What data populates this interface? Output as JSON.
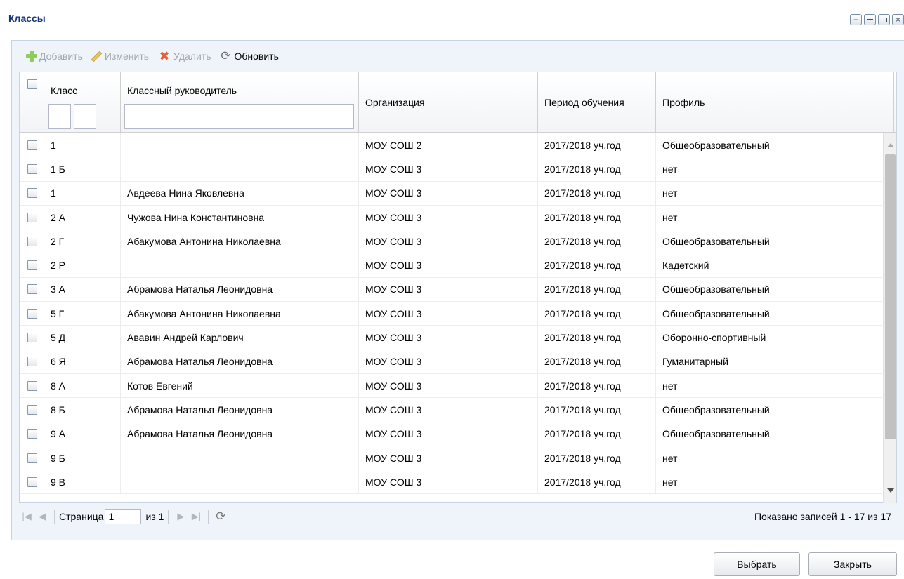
{
  "window": {
    "title": "Классы",
    "tools": [
      "expand-icon",
      "minimize-icon",
      "maximize-icon",
      "close-icon"
    ]
  },
  "toolbar": {
    "add": "Добавить",
    "edit": "Изменить",
    "delete": "Удалить",
    "refresh": "Обновить"
  },
  "grid": {
    "columns": {
      "class": "Класс",
      "teacher": "Классный руководитель",
      "organization": "Организация",
      "period": "Период обучения",
      "profile": "Профиль"
    },
    "rows": [
      {
        "class": "1",
        "teacher": "",
        "organization": "МОУ СОШ 2",
        "period": "2017/2018 уч.год",
        "profile": "Общеобразовательный"
      },
      {
        "class": "1 Б",
        "teacher": "",
        "organization": "МОУ СОШ 3",
        "period": "2017/2018 уч.год",
        "profile": "нет"
      },
      {
        "class": "1",
        "teacher": "Авдеева Нина Яковлевна",
        "organization": "МОУ СОШ 3",
        "period": "2017/2018 уч.год",
        "profile": "нет"
      },
      {
        "class": "2 А",
        "teacher": "Чужова Нина Константиновна",
        "organization": "МОУ СОШ 3",
        "period": "2017/2018 уч.год",
        "profile": "нет"
      },
      {
        "class": "2 Г",
        "teacher": "Абакумова Антонина Николаевна",
        "organization": "МОУ СОШ 3",
        "period": "2017/2018 уч.год",
        "profile": "Общеобразовательный"
      },
      {
        "class": "2 Р",
        "teacher": "",
        "organization": "МОУ СОШ 3",
        "period": "2017/2018 уч.год",
        "profile": "Кадетский"
      },
      {
        "class": "3 А",
        "teacher": "Абрамова Наталья Леонидовна",
        "organization": "МОУ СОШ 3",
        "period": "2017/2018 уч.год",
        "profile": "Общеобразовательный"
      },
      {
        "class": "5 Г",
        "teacher": "Абакумова Антонина Николаевна",
        "organization": "МОУ СОШ 3",
        "period": "2017/2018 уч.год",
        "profile": "Общеобразовательный"
      },
      {
        "class": "5 Д",
        "teacher": "Ававин Андрей Карлович",
        "organization": "МОУ СОШ 3",
        "period": "2017/2018 уч.год",
        "profile": "Оборонно-спортивный"
      },
      {
        "class": "6 Я",
        "teacher": "Абрамова Наталья Леонидовна",
        "organization": "МОУ СОШ 3",
        "period": "2017/2018 уч.год",
        "profile": "Гуманитарный"
      },
      {
        "class": "8 А",
        "teacher": "Котов Евгений",
        "organization": "МОУ СОШ 3",
        "period": "2017/2018 уч.год",
        "profile": "нет"
      },
      {
        "class": "8 Б",
        "teacher": "Абрамова Наталья Леонидовна",
        "organization": "МОУ СОШ 3",
        "period": "2017/2018 уч.год",
        "profile": "Общеобразовательный"
      },
      {
        "class": "9 А",
        "teacher": "Абрамова Наталья Леонидовна",
        "organization": "МОУ СОШ 3",
        "period": "2017/2018 уч.год",
        "profile": "Общеобразовательный"
      },
      {
        "class": "9 Б",
        "teacher": "",
        "organization": "МОУ СОШ 3",
        "period": "2017/2018 уч.год",
        "profile": "нет"
      },
      {
        "class": "9 В",
        "teacher": "",
        "organization": "МОУ СОШ 3",
        "period": "2017/2018 уч.год",
        "profile": "нет"
      }
    ]
  },
  "pager": {
    "page_label": "Страница",
    "page_value": "1",
    "of_label": "из 1",
    "status": "Показано записей 1 - 17 из 17"
  },
  "buttons": {
    "select": "Выбрать",
    "close": "Закрыть"
  }
}
